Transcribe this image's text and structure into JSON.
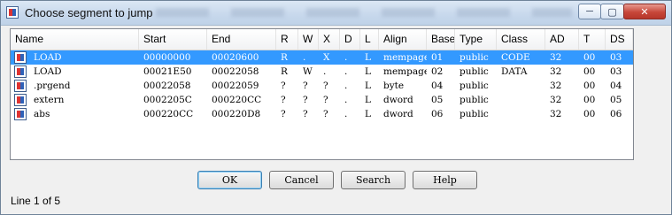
{
  "window": {
    "title": "Choose segment to jump"
  },
  "columns": [
    "Name",
    "Start",
    "End",
    "R",
    "W",
    "X",
    "D",
    "L",
    "Align",
    "Base",
    "Type",
    "Class",
    "AD",
    "T",
    "DS"
  ],
  "rows": [
    {
      "name": "LOAD",
      "start": "00000000",
      "end": "00020600",
      "r": "R",
      "w": ".",
      "x": "X",
      "d": ".",
      "l": "L",
      "align": "mempage",
      "base": "01",
      "type": "public",
      "class": "CODE",
      "ad": "32",
      "t": "00",
      "ds": "03",
      "selected": true
    },
    {
      "name": "LOAD",
      "start": "00021E50",
      "end": "00022058",
      "r": "R",
      "w": "W",
      "x": ".",
      "d": ".",
      "l": "L",
      "align": "mempage",
      "base": "02",
      "type": "public",
      "class": "DATA",
      "ad": "32",
      "t": "00",
      "ds": "03",
      "selected": false
    },
    {
      "name": ".prgend",
      "start": "00022058",
      "end": "00022059",
      "r": "?",
      "w": "?",
      "x": "?",
      "d": ".",
      "l": "L",
      "align": "byte",
      "base": "04",
      "type": "public",
      "class": "",
      "ad": "32",
      "t": "00",
      "ds": "04",
      "selected": false
    },
    {
      "name": "extern",
      "start": "0002205C",
      "end": "000220CC",
      "r": "?",
      "w": "?",
      "x": "?",
      "d": ".",
      "l": "L",
      "align": "dword",
      "base": "05",
      "type": "public",
      "class": "",
      "ad": "32",
      "t": "00",
      "ds": "05",
      "selected": false
    },
    {
      "name": "abs",
      "start": "000220CC",
      "end": "000220D8",
      "r": "?",
      "w": "?",
      "x": "?",
      "d": ".",
      "l": "L",
      "align": "dword",
      "base": "06",
      "type": "public",
      "class": "",
      "ad": "32",
      "t": "00",
      "ds": "06",
      "selected": false
    }
  ],
  "buttons": {
    "ok": "OK",
    "cancel": "Cancel",
    "search": "Search",
    "help": "Help"
  },
  "status": "Line 1 of 5",
  "icons": {
    "app": "segment-table-icon",
    "row": "segment-icon"
  }
}
